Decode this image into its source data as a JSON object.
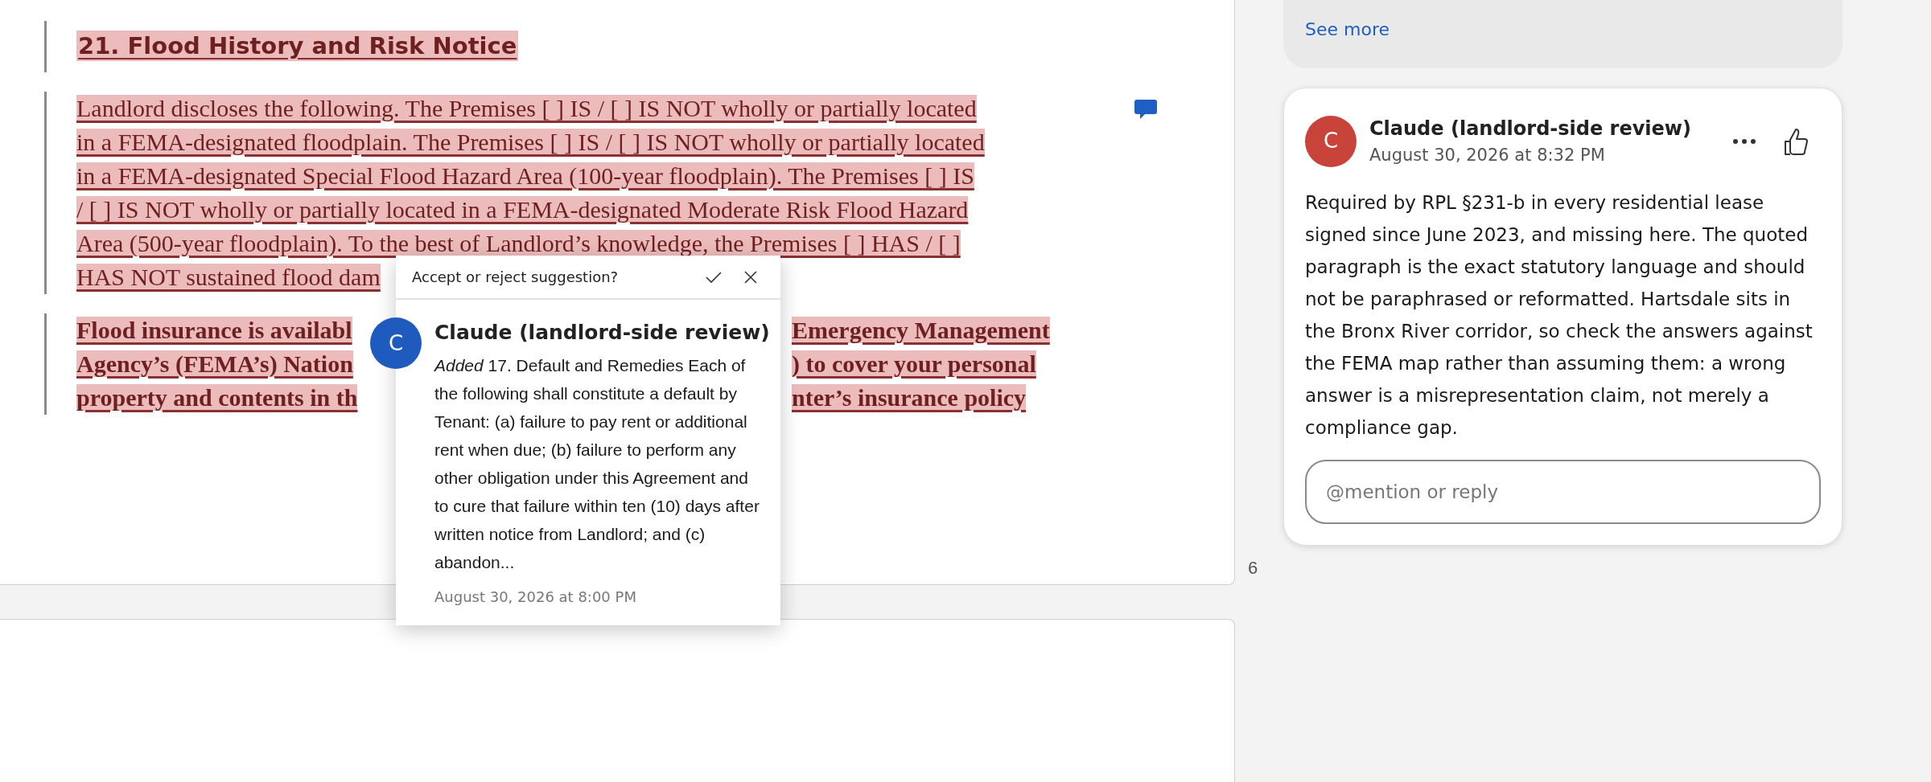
{
  "document": {
    "heading": "21. Flood History and Risk Notice",
    "paragraph_lines": [
      "Landlord discloses the following. The Premises [ ] IS / [ ] IS NOT wholly or partially located",
      "in a FEMA-designated floodplain. The Premises [ ] IS / [ ] IS NOT wholly or partially located",
      "in a FEMA-designated Special Flood Hazard Area (100-year floodplain). The Premises [ ] IS",
      "/ [ ] IS NOT wholly or partially located in a FEMA-designated Moderate Risk Flood Hazard",
      "Area (500-year floodplain). To the best of Landlord’s knowledge, the Premises [ ] HAS / [ ]",
      "HAS NOT sustained flood dam"
    ],
    "bold_lines": [
      {
        "left": "Flood insurance is availabl",
        "right": "Emergency Management"
      },
      {
        "left": "Agency’s (FEMA’s) Nation",
        "right": ") to cover your personal"
      },
      {
        "left": "property and contents in th",
        "right": "nter’s insurance policy"
      }
    ],
    "page_number": "6"
  },
  "suggestion_popup": {
    "title": "Accept or reject suggestion?",
    "avatar": "C",
    "color": "#1f5bbf",
    "author": "Claude (landlord-side review)",
    "body": "*Added* 17. Default and Remedies Each of the following shall constitute a default by Tenant: (a) failure to pay rent or additional rent when due; (b) failure to perform any other obligation under this Agreement and to cure that failure within ten (10) days after written notice from Landlord; and (c) abandon...",
    "time": "August 30, 2026 at 8:00 PM"
  },
  "comments_pane": {
    "see_more": "See more",
    "comment": {
      "avatar": "C",
      "color": "#c8433a",
      "author": "Claude (landlord-side review)",
      "time": "August 30, 2026 at 8:32 PM",
      "body": "Required by RPL §231-b in every residential lease signed since June 2023, and missing here. The quoted paragraph is the exact statutory language and should not be paraphrased or reformatted. Hartsdale sits in the Bronx River corridor, so check the answers against the FEMA map rather than assuming them: a wrong answer is a misrepresentation claim, not merely a compliance gap.",
      "reply_placeholder": "@mention or reply"
    }
  }
}
